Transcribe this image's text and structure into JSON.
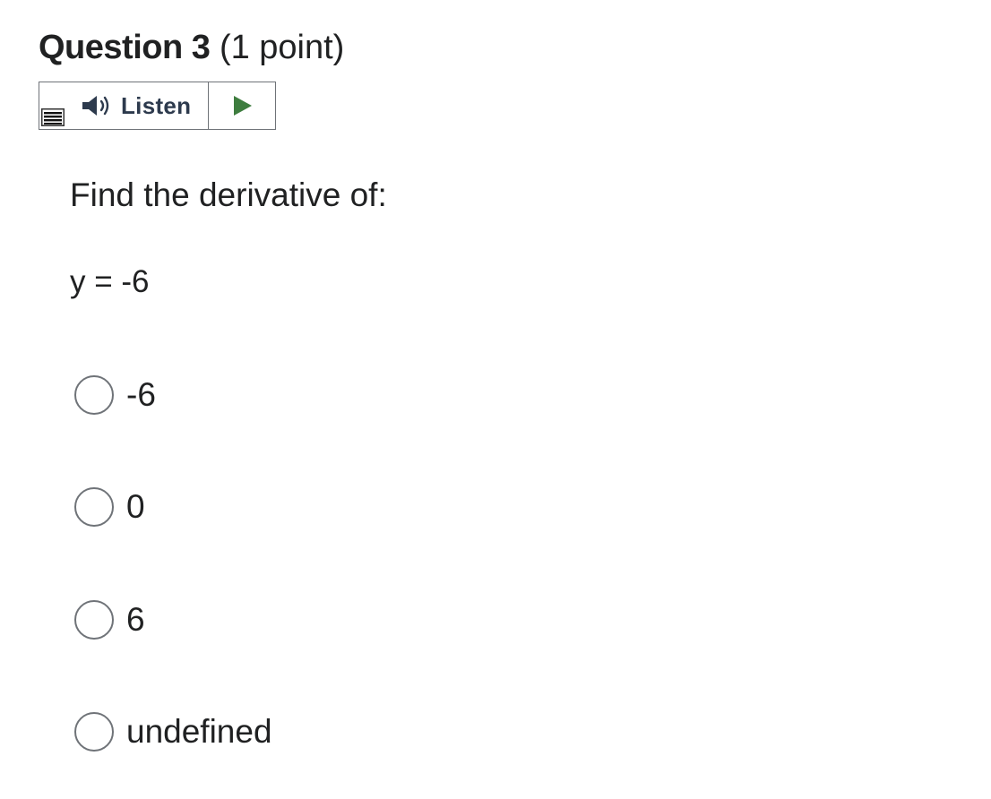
{
  "question": {
    "title": "Question 3",
    "points": "(1 point)"
  },
  "listen_widget": {
    "menu_icon": "menu-bars-icon",
    "speaker_icon": "speaker-icon",
    "listen_label": "Listen",
    "play_icon": "play-icon",
    "accent_color": "#3e7d3f"
  },
  "prompt": "Find the derivative of:",
  "equation": "y = -6",
  "options": [
    {
      "label": "-6",
      "selected": false
    },
    {
      "label": "0",
      "selected": false
    },
    {
      "label": "6",
      "selected": false
    },
    {
      "label": "undefined",
      "selected": false
    }
  ]
}
